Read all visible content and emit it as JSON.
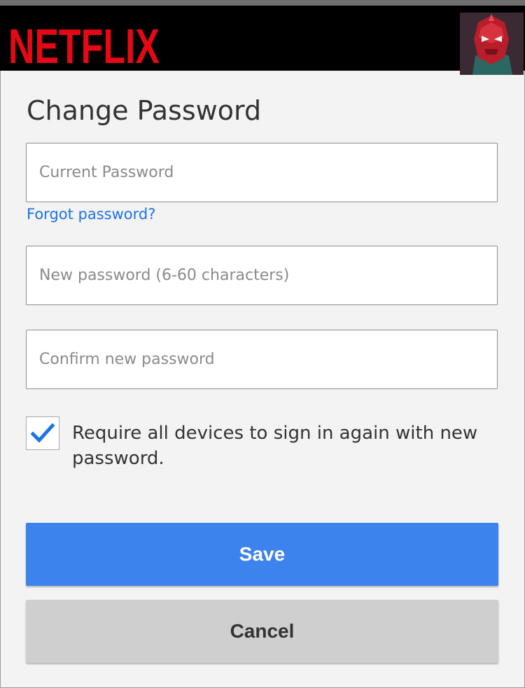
{
  "header": {
    "brand": "NETFLIX",
    "brand_color": "#e50914",
    "avatar_icon": "profile-avatar-icon"
  },
  "main": {
    "title": "Change Password",
    "current_password": {
      "placeholder": "Current Password",
      "value": ""
    },
    "forgot_password_link": "Forgot password?",
    "new_password": {
      "placeholder": "New password (6-60 characters)",
      "value": ""
    },
    "confirm_password": {
      "placeholder": "Confirm new password",
      "value": ""
    },
    "require_sign_in": {
      "checked": true,
      "label": "Require all devices to sign in again with new password."
    },
    "save_label": "Save",
    "cancel_label": "Cancel"
  },
  "colors": {
    "accent_blue": "#3d83ee",
    "link_blue": "#1a73e8",
    "cancel_gray": "#cfcfcf",
    "background": "#f3f3f3"
  }
}
